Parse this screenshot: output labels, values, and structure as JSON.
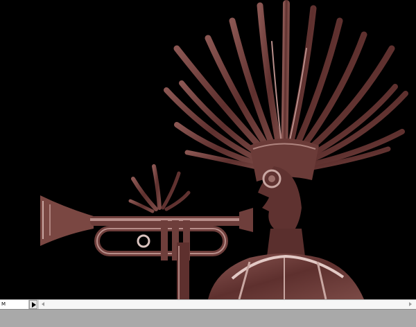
{
  "player": {
    "frame_label": "M",
    "play_icon": "play-triangle-icon",
    "scroll_left_icon": "scroll-left-arrow-icon",
    "scroll_right_icon": "scroll-right-arrow-icon"
  },
  "scene": {
    "background": "#000000",
    "figure_color": "#6e3e3b",
    "highlight_color": "#c9a7a2"
  }
}
